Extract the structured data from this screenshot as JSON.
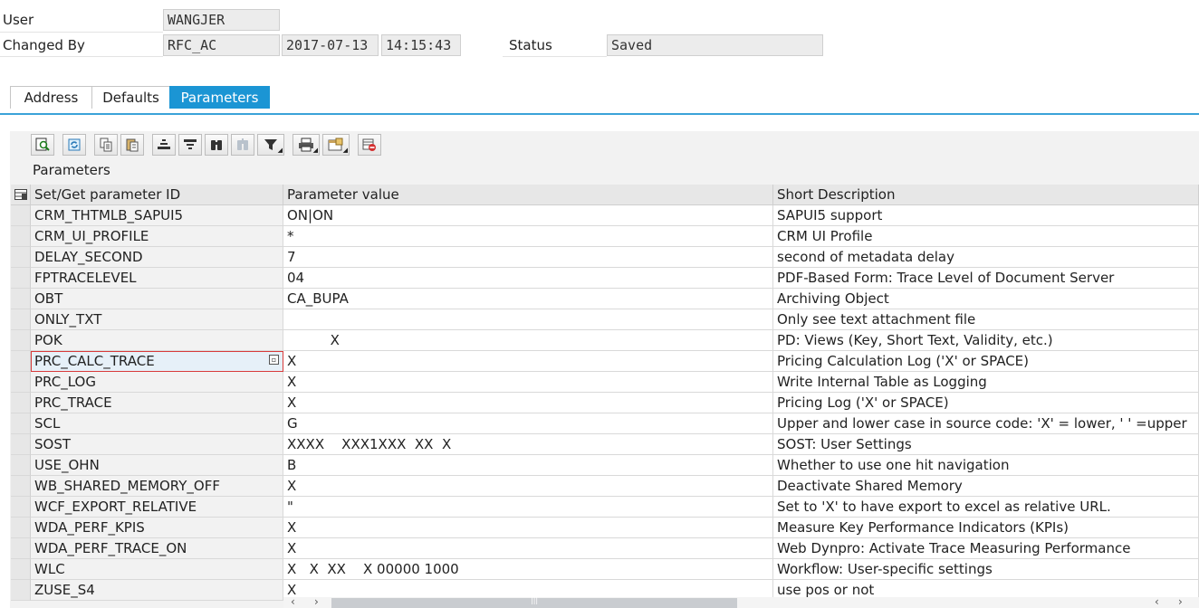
{
  "header": {
    "user_label": "User",
    "user_value": "WANGJER",
    "changed_by_label": "Changed By",
    "changed_by_value": "RFC_AC",
    "changed_date": "2017-07-13",
    "changed_time": "14:15:43",
    "status_label": "Status",
    "status_value": "Saved"
  },
  "tabs": [
    {
      "label": "Address",
      "active": false
    },
    {
      "label": "Defaults",
      "active": false
    },
    {
      "label": "Parameters",
      "active": true
    }
  ],
  "toolbar": {
    "icons": [
      "details-icon",
      "refresh-icon",
      "copy-icon",
      "paste-icon",
      "sort-ascending-icon",
      "sort-descending-icon",
      "find-icon",
      "find-next-icon",
      "filter-icon",
      "print-icon",
      "layout-icon",
      "delete-row-icon"
    ]
  },
  "panel": {
    "title": "Parameters"
  },
  "table": {
    "columns": [
      "Set/Get parameter ID",
      "Parameter value",
      "Short Description"
    ],
    "rows": [
      {
        "id": "CRM_THTMLB_SAPUI5",
        "value": "ON|ON",
        "desc": "SAPUI5 support"
      },
      {
        "id": "CRM_UI_PROFILE",
        "value": "*",
        "desc": "CRM UI Profile"
      },
      {
        "id": "DELAY_SECOND",
        "value": "7",
        "desc": "second of metadata delay"
      },
      {
        "id": "FPTRACELEVEL",
        "value": "04",
        "desc": "PDF-Based Form: Trace Level of Document Server"
      },
      {
        "id": "OBT",
        "value": "CA_BUPA",
        "desc": "Archiving Object"
      },
      {
        "id": "ONLY_TXT",
        "value": "",
        "desc": "Only see text attachment file"
      },
      {
        "id": "POK",
        "value": "          X",
        "desc": "PD: Views (Key, Short Text, Validity, etc.)"
      },
      {
        "id": "PRC_CALC_TRACE",
        "value": "X",
        "desc": "Pricing Calculation Log ('X' or SPACE)"
      },
      {
        "id": "PRC_LOG",
        "value": "X",
        "desc": "Write Internal Table as Logging"
      },
      {
        "id": "PRC_TRACE",
        "value": "X",
        "desc": "Pricing Log ('X' or SPACE)"
      },
      {
        "id": "SCL",
        "value": "G",
        "desc": "Upper and lower case in source code: 'X' = lower, ' ' =upper"
      },
      {
        "id": "SOST",
        "value": "XXXX    XXX1XXX  XX  X",
        "desc": "SOST: User Settings"
      },
      {
        "id": "USE_OHN",
        "value": "B",
        "desc": "Whether to use one hit navigation"
      },
      {
        "id": "WB_SHARED_MEMORY_OFF",
        "value": "X",
        "desc": "Deactivate Shared Memory"
      },
      {
        "id": "WCF_EXPORT_RELATIVE",
        "value": "\"",
        "desc": "Set to 'X' to have export to excel as relative URL."
      },
      {
        "id": "WDA_PERF_KPIS",
        "value": "X",
        "desc": "Measure Key Performance Indicators (KPIs)"
      },
      {
        "id": "WDA_PERF_TRACE_ON",
        "value": "X",
        "desc": "Web Dynpro: Activate Trace Measuring Performance"
      },
      {
        "id": "WLC",
        "value": "X   X  XX    X 00000 1000",
        "desc": "Workflow: User-specific settings"
      },
      {
        "id": "ZUSE_S4",
        "value": "X",
        "desc": "use pos or not"
      }
    ]
  },
  "colors": {
    "accent": "#1b95d4",
    "focus_border": "#d83a3a"
  }
}
